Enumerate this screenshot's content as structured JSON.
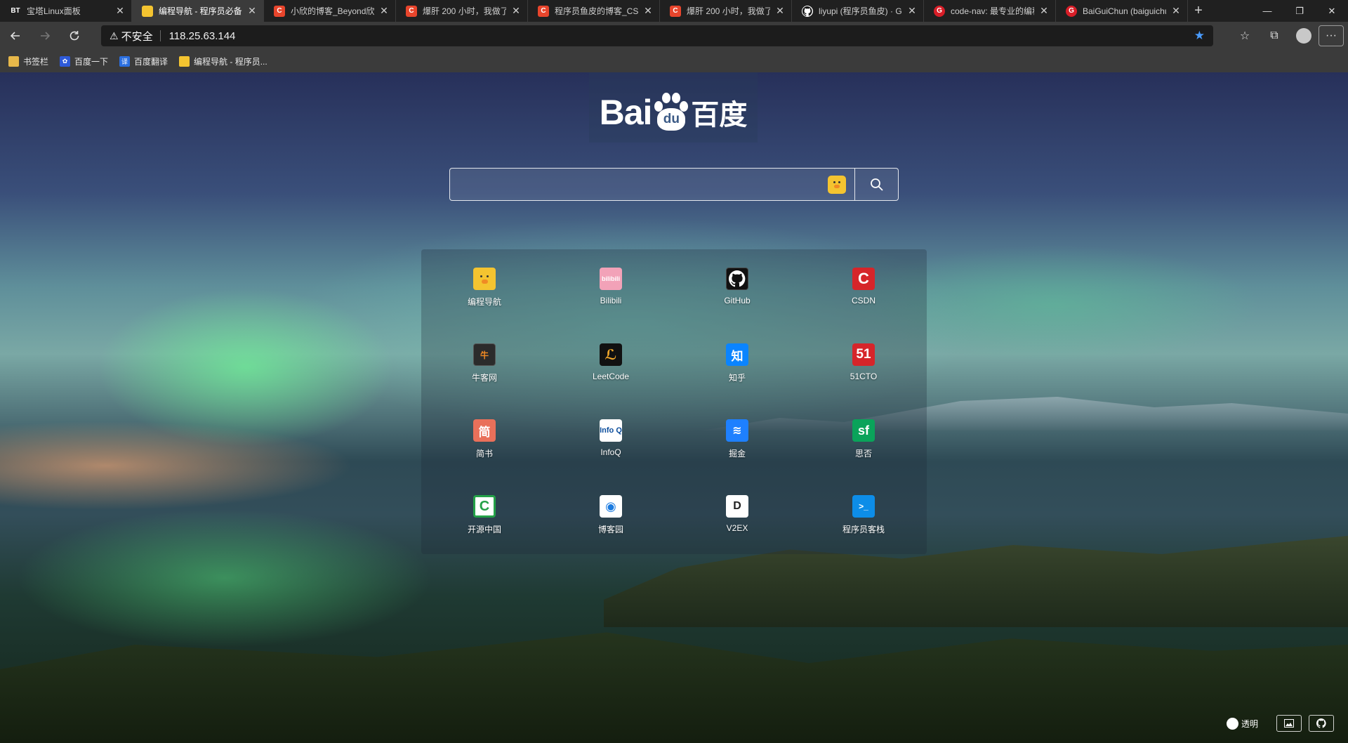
{
  "tabs": [
    {
      "icon": "bt-icon",
      "fav_text": "BT",
      "title": "宝塔Linux面板",
      "active": false
    },
    {
      "icon": "duck-icon",
      "fav_text": "",
      "title": "编程导航 - 程序员必备",
      "active": true
    },
    {
      "icon": "csdn-icon",
      "fav_text": "C",
      "title": "小欣的博客_Beyond欣",
      "active": false
    },
    {
      "icon": "csdn-icon",
      "fav_text": "C",
      "title": "爆肝 200 小时，我做了",
      "active": false
    },
    {
      "icon": "csdn-icon",
      "fav_text": "C",
      "title": "程序员鱼皮的博客_CSD",
      "active": false
    },
    {
      "icon": "csdn-icon",
      "fav_text": "C",
      "title": "爆肝 200 小时，我做了",
      "active": false
    },
    {
      "icon": "github-icon",
      "fav_text": "",
      "title": "liyupi (程序员鱼皮) · Git",
      "active": false
    },
    {
      "icon": "gitee-icon",
      "fav_text": "G",
      "title": "code-nav: 最专业的编程",
      "active": false
    },
    {
      "icon": "gitee-icon",
      "fav_text": "G",
      "title": "BaiGuiChun (baiguichun",
      "active": false
    }
  ],
  "addressbar": {
    "security_label": "不安全",
    "url": "118.25.63.144"
  },
  "bookmarks": [
    {
      "icon": "folder-icon",
      "label": "书签栏"
    },
    {
      "icon": "baidu-icon",
      "label": "百度一下"
    },
    {
      "icon": "translate-icon",
      "label": "百度翻译"
    },
    {
      "icon": "duck-icon",
      "label": "编程导航 - 程序员..."
    }
  ],
  "logo": {
    "left_text": "Bai",
    "paw_text": "du",
    "right_text": "百度"
  },
  "search": {
    "value": "",
    "placeholder": ""
  },
  "sites": [
    {
      "label": "编程导航",
      "glyph": "",
      "icon": "duck-icon"
    },
    {
      "label": "Bilibili",
      "glyph": "bilibili",
      "icon": "bilibili-icon"
    },
    {
      "label": "GitHub",
      "glyph": "",
      "icon": "github-icon"
    },
    {
      "label": "CSDN",
      "glyph": "C",
      "icon": "csdn-icon"
    },
    {
      "label": "牛客网",
      "glyph": "牛",
      "icon": "nowcoder-icon"
    },
    {
      "label": "LeetCode",
      "glyph": "ℒ",
      "icon": "leetcode-icon"
    },
    {
      "label": "知乎",
      "glyph": "知",
      "icon": "zhihu-icon"
    },
    {
      "label": "51CTO",
      "glyph": "51",
      "icon": "51cto-icon"
    },
    {
      "label": "简书",
      "glyph": "简",
      "icon": "jianshu-icon"
    },
    {
      "label": "InfoQ",
      "glyph": "Info Q",
      "icon": "infoq-icon"
    },
    {
      "label": "掘金",
      "glyph": "≋",
      "icon": "juejin-icon"
    },
    {
      "label": "思否",
      "glyph": "sf",
      "icon": "segmentfault-icon"
    },
    {
      "label": "开源中国",
      "glyph": "C",
      "icon": "oschina-icon"
    },
    {
      "label": "博客园",
      "glyph": "◉",
      "icon": "cnblogs-icon"
    },
    {
      "label": "V2EX",
      "glyph": "D",
      "icon": "v2ex-icon"
    },
    {
      "label": "程序员客栈",
      "glyph": ">_",
      "icon": "proginn-icon"
    }
  ],
  "bottom": {
    "transparent_label": "透明"
  }
}
